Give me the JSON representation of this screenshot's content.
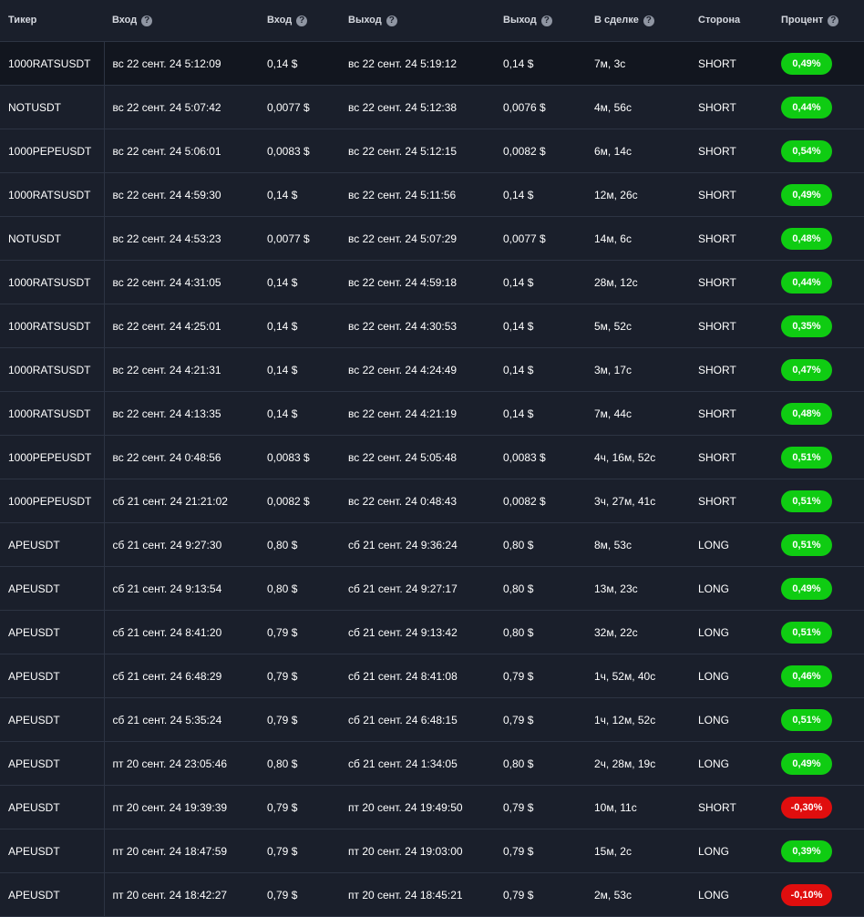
{
  "header": {
    "ticker": "Тикер",
    "entry_time": "Вход",
    "entry_price": "Вход",
    "exit_time": "Выход",
    "exit_price": "Выход",
    "duration": "В сделке",
    "side": "Сторона",
    "percent": "Процент",
    "help_glyph": "?"
  },
  "colors": {
    "positive": "#0fcc12",
    "negative": "#e00e0e",
    "background": "#1a1f2b"
  },
  "rows": [
    {
      "ticker": "1000RATSUSDT",
      "entry_time": "вс 22 сент. 24 5:12:09",
      "entry_price": "0,14 $",
      "exit_time": "вс 22 сент. 24 5:19:12",
      "exit_price": "0,14 $",
      "duration": "7м, 3с",
      "side": "SHORT",
      "percent": "0,49%",
      "sign": "pos"
    },
    {
      "ticker": "NOTUSDT",
      "entry_time": "вс 22 сент. 24 5:07:42",
      "entry_price": "0,0077 $",
      "exit_time": "вс 22 сент. 24 5:12:38",
      "exit_price": "0,0076 $",
      "duration": "4м, 56с",
      "side": "SHORT",
      "percent": "0,44%",
      "sign": "pos"
    },
    {
      "ticker": "1000PEPEUSDT",
      "entry_time": "вс 22 сент. 24 5:06:01",
      "entry_price": "0,0083 $",
      "exit_time": "вс 22 сент. 24 5:12:15",
      "exit_price": "0,0082 $",
      "duration": "6м, 14с",
      "side": "SHORT",
      "percent": "0,54%",
      "sign": "pos"
    },
    {
      "ticker": "1000RATSUSDT",
      "entry_time": "вс 22 сент. 24 4:59:30",
      "entry_price": "0,14 $",
      "exit_time": "вс 22 сент. 24 5:11:56",
      "exit_price": "0,14 $",
      "duration": "12м, 26с",
      "side": "SHORT",
      "percent": "0,49%",
      "sign": "pos"
    },
    {
      "ticker": "NOTUSDT",
      "entry_time": "вс 22 сент. 24 4:53:23",
      "entry_price": "0,0077 $",
      "exit_time": "вс 22 сент. 24 5:07:29",
      "exit_price": "0,0077 $",
      "duration": "14м, 6с",
      "side": "SHORT",
      "percent": "0,48%",
      "sign": "pos"
    },
    {
      "ticker": "1000RATSUSDT",
      "entry_time": "вс 22 сент. 24 4:31:05",
      "entry_price": "0,14 $",
      "exit_time": "вс 22 сент. 24 4:59:18",
      "exit_price": "0,14 $",
      "duration": "28м, 12с",
      "side": "SHORT",
      "percent": "0,44%",
      "sign": "pos"
    },
    {
      "ticker": "1000RATSUSDT",
      "entry_time": "вс 22 сент. 24 4:25:01",
      "entry_price": "0,14 $",
      "exit_time": "вс 22 сент. 24 4:30:53",
      "exit_price": "0,14 $",
      "duration": "5м, 52с",
      "side": "SHORT",
      "percent": "0,35%",
      "sign": "pos"
    },
    {
      "ticker": "1000RATSUSDT",
      "entry_time": "вс 22 сент. 24 4:21:31",
      "entry_price": "0,14 $",
      "exit_time": "вс 22 сент. 24 4:24:49",
      "exit_price": "0,14 $",
      "duration": "3м, 17с",
      "side": "SHORT",
      "percent": "0,47%",
      "sign": "pos"
    },
    {
      "ticker": "1000RATSUSDT",
      "entry_time": "вс 22 сент. 24 4:13:35",
      "entry_price": "0,14 $",
      "exit_time": "вс 22 сент. 24 4:21:19",
      "exit_price": "0,14 $",
      "duration": "7м, 44с",
      "side": "SHORT",
      "percent": "0,48%",
      "sign": "pos"
    },
    {
      "ticker": "1000PEPEUSDT",
      "entry_time": "вс 22 сент. 24 0:48:56",
      "entry_price": "0,0083 $",
      "exit_time": "вс 22 сент. 24 5:05:48",
      "exit_price": "0,0083 $",
      "duration": "4ч, 16м, 52с",
      "side": "SHORT",
      "percent": "0,51%",
      "sign": "pos"
    },
    {
      "ticker": "1000PEPEUSDT",
      "entry_time": "сб 21 сент. 24 21:21:02",
      "entry_price": "0,0082 $",
      "exit_time": "вс 22 сент. 24 0:48:43",
      "exit_price": "0,0082 $",
      "duration": "3ч, 27м, 41с",
      "side": "SHORT",
      "percent": "0,51%",
      "sign": "pos"
    },
    {
      "ticker": "APEUSDT",
      "entry_time": "сб 21 сент. 24 9:27:30",
      "entry_price": "0,80 $",
      "exit_time": "сб 21 сент. 24 9:36:24",
      "exit_price": "0,80 $",
      "duration": "8м, 53с",
      "side": "LONG",
      "percent": "0,51%",
      "sign": "pos"
    },
    {
      "ticker": "APEUSDT",
      "entry_time": "сб 21 сент. 24 9:13:54",
      "entry_price": "0,80 $",
      "exit_time": "сб 21 сент. 24 9:27:17",
      "exit_price": "0,80 $",
      "duration": "13м, 23с",
      "side": "LONG",
      "percent": "0,49%",
      "sign": "pos"
    },
    {
      "ticker": "APEUSDT",
      "entry_time": "сб 21 сент. 24 8:41:20",
      "entry_price": "0,79 $",
      "exit_time": "сб 21 сент. 24 9:13:42",
      "exit_price": "0,80 $",
      "duration": "32м, 22с",
      "side": "LONG",
      "percent": "0,51%",
      "sign": "pos"
    },
    {
      "ticker": "APEUSDT",
      "entry_time": "сб 21 сент. 24 6:48:29",
      "entry_price": "0,79 $",
      "exit_time": "сб 21 сент. 24 8:41:08",
      "exit_price": "0,79 $",
      "duration": "1ч, 52м, 40с",
      "side": "LONG",
      "percent": "0,46%",
      "sign": "pos"
    },
    {
      "ticker": "APEUSDT",
      "entry_time": "сб 21 сент. 24 5:35:24",
      "entry_price": "0,79 $",
      "exit_time": "сб 21 сент. 24 6:48:15",
      "exit_price": "0,79 $",
      "duration": "1ч, 12м, 52с",
      "side": "LONG",
      "percent": "0,51%",
      "sign": "pos"
    },
    {
      "ticker": "APEUSDT",
      "entry_time": "пт 20 сент. 24 23:05:46",
      "entry_price": "0,80 $",
      "exit_time": "сб 21 сент. 24 1:34:05",
      "exit_price": "0,80 $",
      "duration": "2ч, 28м, 19с",
      "side": "LONG",
      "percent": "0,49%",
      "sign": "pos"
    },
    {
      "ticker": "APEUSDT",
      "entry_time": "пт 20 сент. 24 19:39:39",
      "entry_price": "0,79 $",
      "exit_time": "пт 20 сент. 24 19:49:50",
      "exit_price": "0,79 $",
      "duration": "10м, 11с",
      "side": "SHORT",
      "percent": "-0,30%",
      "sign": "neg"
    },
    {
      "ticker": "APEUSDT",
      "entry_time": "пт 20 сент. 24 18:47:59",
      "entry_price": "0,79 $",
      "exit_time": "пт 20 сент. 24 19:03:00",
      "exit_price": "0,79 $",
      "duration": "15м, 2с",
      "side": "LONG",
      "percent": "0,39%",
      "sign": "pos"
    },
    {
      "ticker": "APEUSDT",
      "entry_time": "пт 20 сент. 24 18:42:27",
      "entry_price": "0,79 $",
      "exit_time": "пт 20 сент. 24 18:45:21",
      "exit_price": "0,79 $",
      "duration": "2м, 53с",
      "side": "LONG",
      "percent": "-0,10%",
      "sign": "neg"
    }
  ]
}
